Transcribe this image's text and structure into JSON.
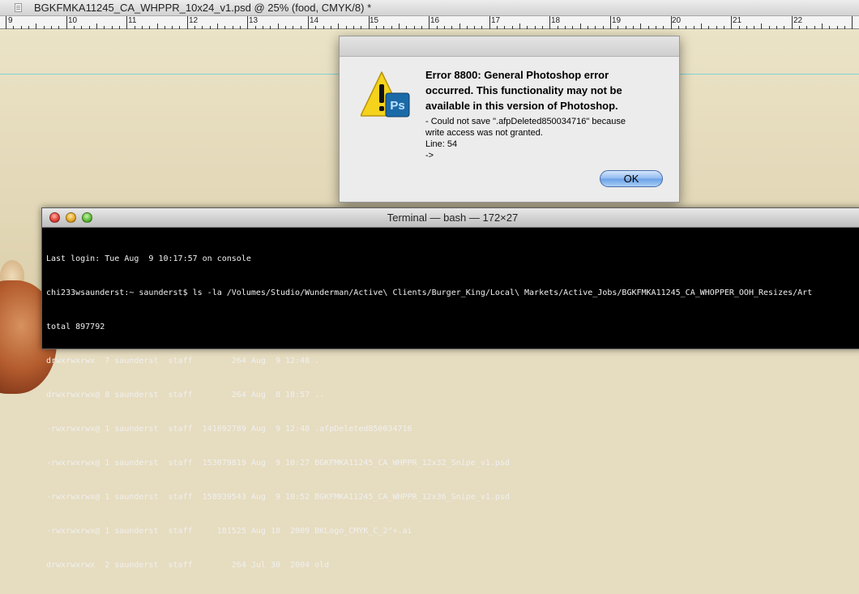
{
  "photoshop": {
    "document_title": "BGKFMKA11245_CA_WHPPR_10x24_v1.psd @ 25% (food, CMYK/8) *",
    "ruler_labels": [
      "9",
      "10",
      "11",
      "12",
      "13",
      "14",
      "15",
      "16",
      "17",
      "18",
      "19",
      "20",
      "21",
      "22"
    ]
  },
  "dialog": {
    "title": "Error 8800: General Photoshop error\noccurred. This functionality may not be\navailable in this version of Photoshop.",
    "body": "- Could not save \".afpDeleted850034716\" because\nwrite access was not granted.\nLine: 54\n->",
    "ok_label": "OK",
    "app_badge": "Ps"
  },
  "terminal": {
    "title": "Terminal — bash — 172×27",
    "lines": [
      "Last login: Tue Aug  9 10:17:57 on console",
      "chi233wsaunderst:~ saunderst$ ls -la /Volumes/Studio/Wunderman/Active\\ Clients/Burger_King/Local\\ Markets/Active_Jobs/BGKFMKA11245_CA_WHOPPER_OOH_Resizes/Art",
      "total 897792",
      "drwxrwxrwx  7 saunderst  staff        264 Aug  9 12:48 .",
      "drwxrwxrwx@ 8 saunderst  staff        264 Aug  8 18:57 ..",
      "-rwxrwxrwx@ 1 saunderst  staff  141692789 Aug  9 12:48 .afpDeleted850034716",
      "-rwxrwxrwx@ 1 saunderst  staff  153079819 Aug  9 10:27 BGKFMKA11245_CA_WHPPR_12x32_Snipe_v1.psd",
      "-rwxrwxrwx@ 1 saunderst  staff  158939543 Aug  9 10:52 BGKFMKA11245_CA_WHPPR_12x36_Snipe_v1.psd",
      "-rwxrwxrwx@ 1 saunderst  staff     181525 Aug 18  2009 BKLogo_CMYK_C_2\"+.ai",
      "drwxrwxrwx  2 saunderst  staff        264 Jul 30  2004 old"
    ]
  },
  "colors": {
    "terminal_bg": "#000000",
    "terminal_text": "#f0f0f0",
    "guide": "#7fd3d7",
    "warning_yellow": "#f5d21c",
    "ps_blue": "#1b6aa8"
  }
}
